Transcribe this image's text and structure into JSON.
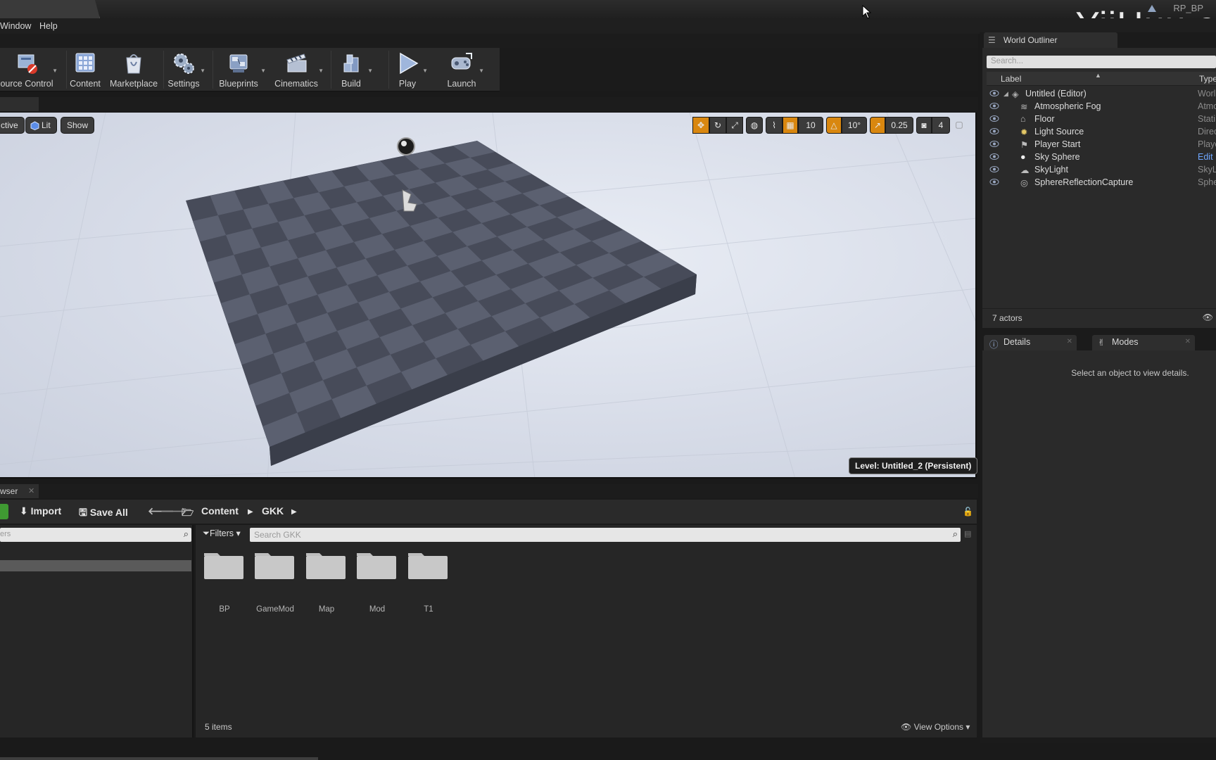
{
  "window": {
    "project_name": "RP_BP",
    "watermark": "YiiHuu.c"
  },
  "menu": {
    "items": [
      "Window",
      "Help"
    ]
  },
  "toolbar": {
    "buttons": [
      {
        "label": "ource Control",
        "icon": "source-control-icon"
      },
      {
        "label": "Content",
        "icon": "content-icon"
      },
      {
        "label": "Marketplace",
        "icon": "marketplace-icon"
      },
      {
        "label": "Settings",
        "icon": "settings-gear-icon"
      },
      {
        "label": "Blueprints",
        "icon": "blueprints-icon"
      },
      {
        "label": "Cinematics",
        "icon": "clapperboard-icon"
      },
      {
        "label": "Build",
        "icon": "build-icon"
      },
      {
        "label": "Play",
        "icon": "play-icon"
      },
      {
        "label": "Launch",
        "icon": "launch-icon"
      }
    ]
  },
  "viewport": {
    "perspective_label": "ctive",
    "lit_label": "Lit",
    "show_label": "Show",
    "grid_snap": "10",
    "rotation_snap": "10°",
    "scale_snap": "0.25",
    "camera_speed": "4",
    "level_label": "Level:  Untitled_2 (Persistent)"
  },
  "content_browser": {
    "tab_label": "wser",
    "import_label": "Import",
    "save_all_label": "Save All",
    "breadcrumb": [
      "Content",
      "GKK"
    ],
    "left_search_placeholder": "ers",
    "filters_label": "Filters",
    "search_placeholder": "Search GKK",
    "folders": [
      "BP",
      "GameMod",
      "Map",
      "Mod",
      "T1"
    ],
    "item_count": "5 items",
    "view_options_label": "View Options"
  },
  "world_outliner": {
    "title": "World Outliner",
    "search_placeholder": "Search...",
    "col_label": "Label",
    "col_type": "Type",
    "rows": [
      {
        "label": "Untitled (Editor)",
        "type": "World"
      },
      {
        "label": "Atmospheric Fog",
        "type": "Atmo"
      },
      {
        "label": "Floor",
        "type": "Stati"
      },
      {
        "label": "Light Source",
        "type": "Direc"
      },
      {
        "label": "Player Start",
        "type": "Playe"
      },
      {
        "label": "Sky Sphere",
        "type": "Edit"
      },
      {
        "label": "SkyLight",
        "type": "SkyL"
      },
      {
        "label": "SphereReflectionCapture",
        "type": "Sphe"
      }
    ],
    "actor_count": "7 actors"
  },
  "details": {
    "tab_details": "Details",
    "tab_modes": "Modes",
    "hint": "Select an object to view details."
  }
}
